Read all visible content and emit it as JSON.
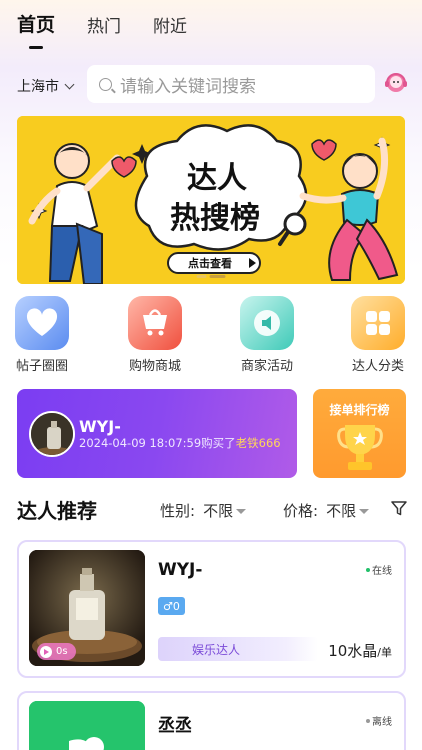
{
  "tabs": [
    "首页",
    "热门",
    "附近"
  ],
  "location": "上海市",
  "search": {
    "placeholder": "请输入关键词搜索"
  },
  "banner": {
    "title_line1": "达人",
    "title_line2": "热搜榜",
    "button": "点击查看"
  },
  "quick_entries": [
    {
      "label": "帖子圈圈",
      "icon": "heart-icon",
      "color": "#7aa8f5"
    },
    {
      "label": "购物商城",
      "icon": "shopping-cart-icon",
      "color": "#f25a5a"
    },
    {
      "label": "商家活动",
      "icon": "speaker-icon",
      "color": "#3fd0c0"
    },
    {
      "label": "达人分类",
      "icon": "grid-icon",
      "color": "#ffb43a"
    }
  ],
  "purchase_card": {
    "name": "WYJ-",
    "time": "2024-04-09 18:07:59",
    "action": "购买了",
    "target": "老铁666"
  },
  "ranking_card": {
    "title": "接单排行榜"
  },
  "section": {
    "title": "达人推荐",
    "filters": [
      {
        "label": "性别:",
        "value": "不限"
      },
      {
        "label": "价格:",
        "value": "不限"
      }
    ]
  },
  "experts": [
    {
      "name": "WYJ-",
      "status": "在线",
      "status_color": "#22c06a",
      "gender": "♂0",
      "video": "0s",
      "category": "娱乐达人",
      "price": "10水晶",
      "unit": "/单"
    },
    {
      "name": "丞丞",
      "status": "离线",
      "status_color": "#999999"
    }
  ]
}
